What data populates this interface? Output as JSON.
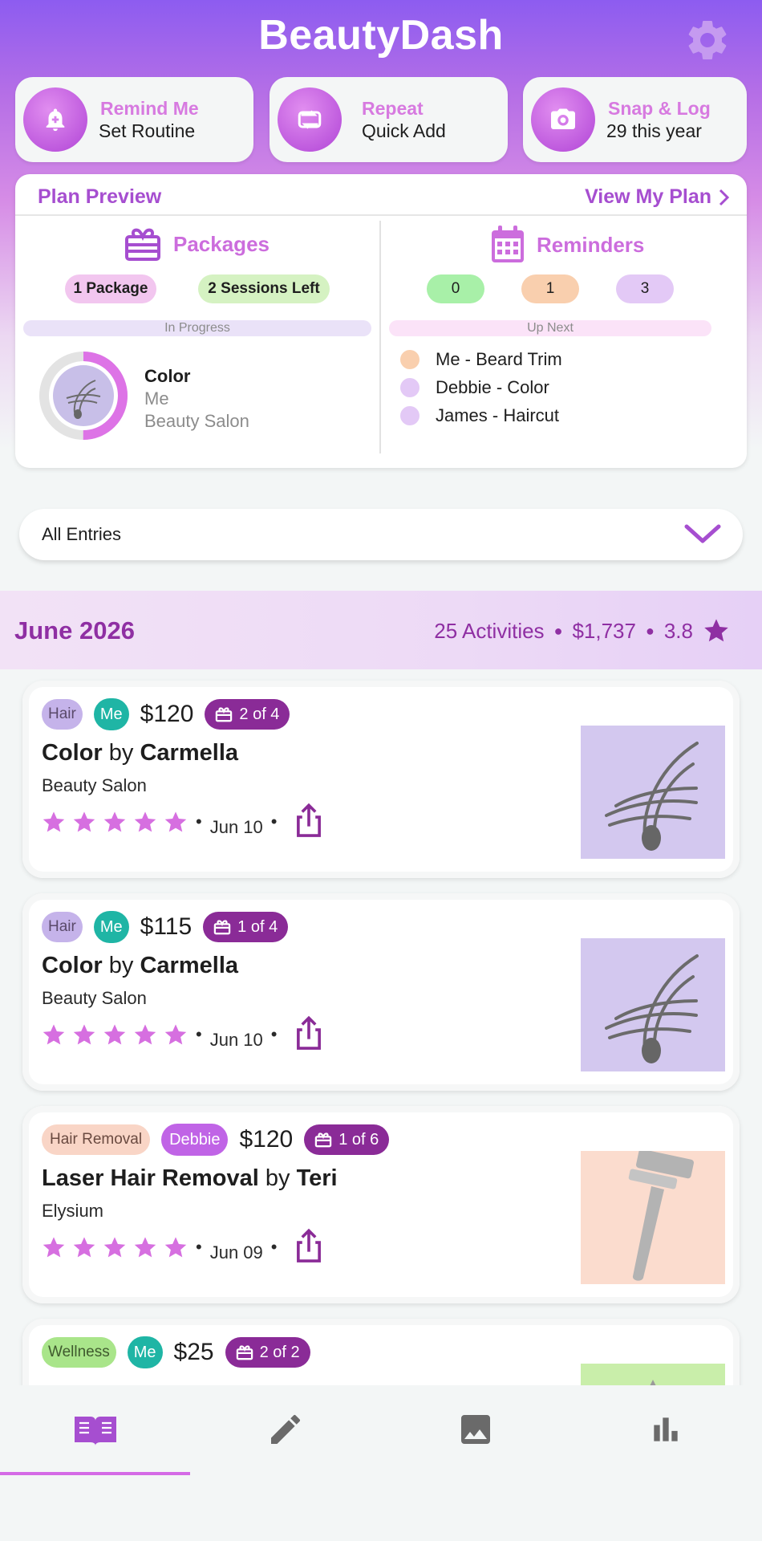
{
  "app": {
    "title": "BeautyDash"
  },
  "quick_actions": [
    {
      "title": "Remind Me",
      "subtitle": "Set Routine",
      "icon": "bell-plus-icon"
    },
    {
      "title": "Repeat",
      "subtitle": "Quick Add",
      "icon": "repeat-icon"
    },
    {
      "title": "Snap & Log",
      "subtitle": "29 this year",
      "icon": "camera-icon"
    }
  ],
  "plan": {
    "title": "Plan Preview",
    "link": "View My Plan",
    "packages": {
      "heading": "Packages",
      "pills": [
        "1 Package",
        "2 Sessions Left"
      ],
      "status": "In Progress",
      "item_title": "Color",
      "item_person": "Me",
      "item_place": "Beauty Salon",
      "progress": 0.5
    },
    "reminders": {
      "heading": "Reminders",
      "counts": [
        "0",
        "1",
        "3"
      ],
      "status": "Up Next",
      "items": [
        {
          "label": "Me - Beard Trim",
          "color": "#f9cfae"
        },
        {
          "label": "Debbie - Color",
          "color": "#e3c9f6"
        },
        {
          "label": "James - Haircut",
          "color": "#e3c9f6"
        }
      ]
    }
  },
  "filter": {
    "label": "All Entries"
  },
  "month": {
    "title": "June 2026",
    "activities": "25 Activities",
    "total": "$1,737",
    "rating": "3.8"
  },
  "entries": [
    {
      "category": "Hair",
      "person": "Me",
      "price": "$120",
      "sessions": "2 of 4",
      "service": "Color",
      "by": "by",
      "provider": "Carmella",
      "location": "Beauty Salon",
      "date": "Jun 10",
      "stars": 5,
      "thumb": "hair"
    },
    {
      "category": "Hair",
      "person": "Me",
      "price": "$115",
      "sessions": "1 of 4",
      "service": "Color",
      "by": "by",
      "provider": "Carmella",
      "location": "Beauty Salon",
      "date": "Jun 10",
      "stars": 5,
      "thumb": "hair"
    },
    {
      "category": "Hair Removal",
      "person": "Debbie",
      "price": "$120",
      "sessions": "1 of 6",
      "service": "Laser Hair Removal",
      "by": "by",
      "provider": "Teri",
      "location": "Elysium",
      "date": "Jun 09",
      "stars": 5,
      "thumb": "razor"
    },
    {
      "category": "Wellness",
      "person": "Me",
      "price": "$25",
      "sessions": "2 of 2",
      "service": "",
      "by": "",
      "provider": "",
      "location": "",
      "date": "",
      "stars": 0,
      "thumb": "wellness"
    }
  ],
  "colors": {
    "accent": "#a64ed0",
    "hair_tag": "#c5b3ea",
    "hair_removal_tag": "#f9d5c6",
    "wellness_tag": "#a9e58a",
    "me_tag": "#1fb5a5",
    "debbie_tag": "#c064e6",
    "sessions_badge": "#8a2b97",
    "star": "#d66fe0"
  },
  "nav": {
    "items": [
      "journal-icon",
      "edit-icon",
      "gallery-icon",
      "stats-icon"
    ],
    "active": 0
  }
}
